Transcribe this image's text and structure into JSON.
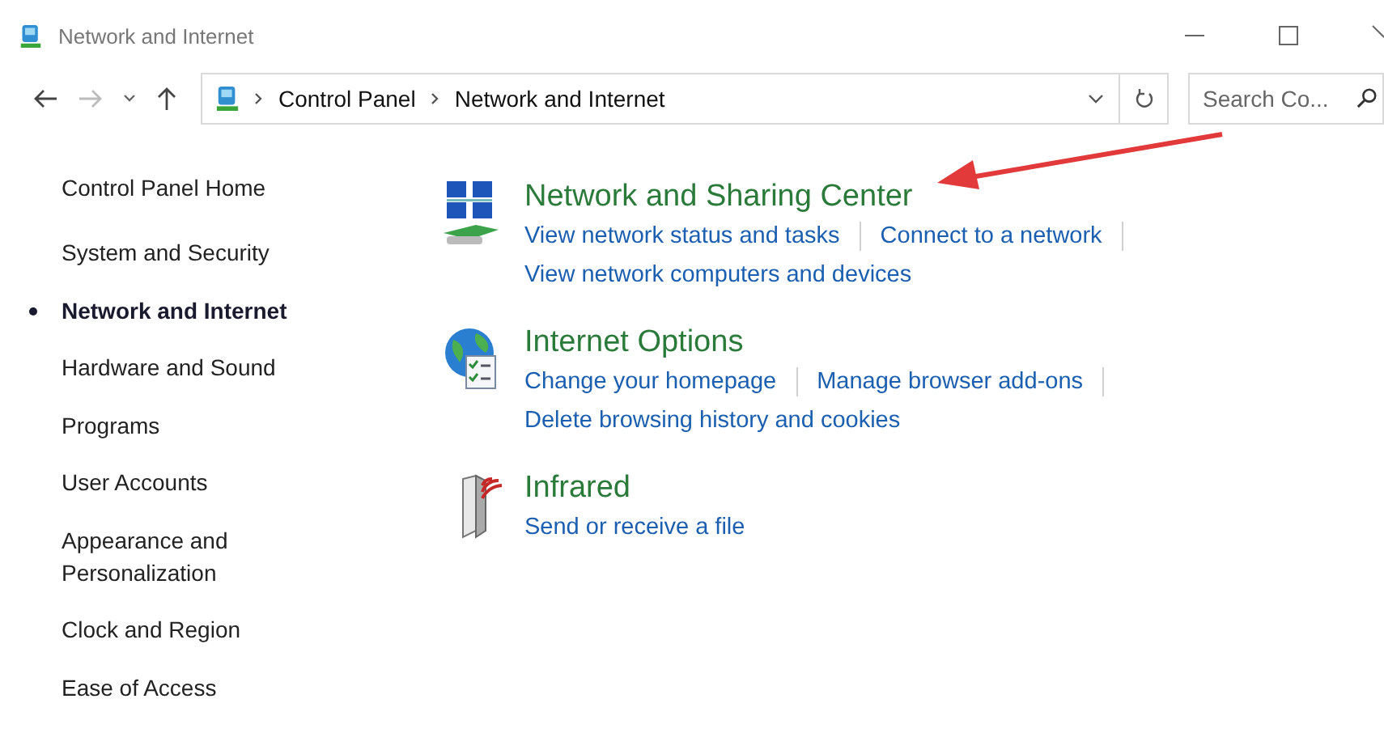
{
  "window": {
    "title": "Network and Internet"
  },
  "address_bar": {
    "path": [
      "Control Panel",
      "Network and Internet"
    ]
  },
  "search": {
    "placeholder": "Search Co..."
  },
  "sidebar": {
    "home": "Control Panel Home",
    "items": [
      {
        "label": "System and Security",
        "selected": false
      },
      {
        "label": "Network and Internet",
        "selected": true
      },
      {
        "label": "Hardware and Sound",
        "selected": false
      },
      {
        "label": "Programs",
        "selected": false
      },
      {
        "label": "User Accounts",
        "selected": false
      },
      {
        "label": "Appearance and Personalization",
        "selected": false
      },
      {
        "label": "Clock and Region",
        "selected": false
      },
      {
        "label": "Ease of Access",
        "selected": false
      }
    ]
  },
  "categories": [
    {
      "kind": "network",
      "title": "Network and Sharing Center",
      "lines": [
        [
          "View network status and tasks",
          "Connect to a network"
        ],
        [
          "View network computers and devices"
        ]
      ]
    },
    {
      "kind": "internet",
      "title": "Internet Options",
      "lines": [
        [
          "Change your homepage",
          "Manage browser add-ons"
        ],
        [
          "Delete browsing history and cookies"
        ]
      ]
    },
    {
      "kind": "infrared",
      "title": "Infrared",
      "lines": [
        [
          "Send or receive a file"
        ]
      ]
    }
  ]
}
